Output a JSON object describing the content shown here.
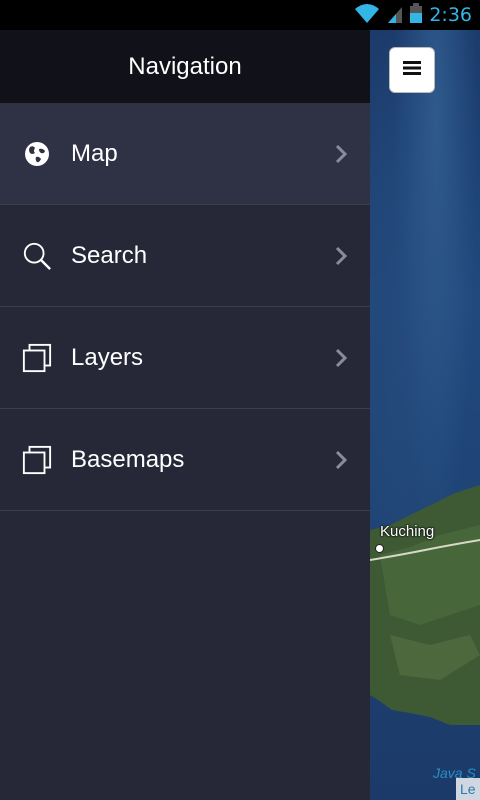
{
  "status_bar": {
    "time": "2:36",
    "icons": [
      "wifi-icon",
      "signal-icon",
      "battery-icon"
    ],
    "accent_color": "#33b5e5"
  },
  "drawer": {
    "title": "Navigation",
    "items": [
      {
        "label": "Map",
        "icon": "globe-icon",
        "active": true
      },
      {
        "label": "Search",
        "icon": "search-icon",
        "active": false
      },
      {
        "label": "Layers",
        "icon": "layers-icon",
        "active": false
      },
      {
        "label": "Basemaps",
        "icon": "layers-icon",
        "active": false
      }
    ]
  },
  "map": {
    "menu_button_icon": "hamburger-icon",
    "place_label": "Kuching",
    "sea_label": "Java S",
    "attribution": "Le"
  }
}
